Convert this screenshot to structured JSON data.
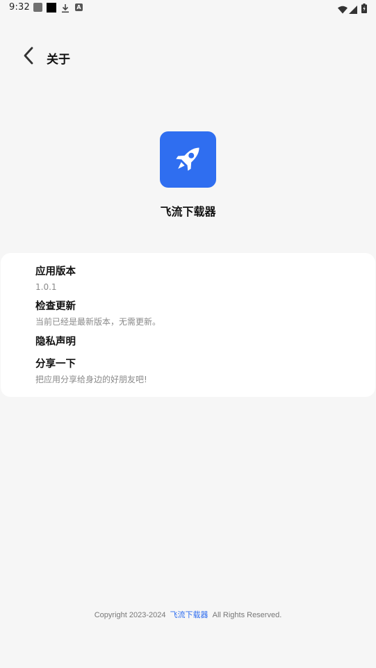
{
  "status_bar": {
    "time": "9:32",
    "icons": [
      "gray-square-icon",
      "black-square-icon",
      "download-icon",
      "a-badge-icon",
      "wifi-icon",
      "signal-icon",
      "battery-icon"
    ]
  },
  "header": {
    "title": "关于",
    "back_icon": "chevron-left-icon"
  },
  "app": {
    "name": "飞流下载器",
    "icon": "rocket-icon",
    "icon_bg": "#2f6ef0"
  },
  "info": {
    "items": [
      {
        "title": "应用版本",
        "subtitle": "1.0.1"
      },
      {
        "title": "检查更新",
        "subtitle": "当前已经是最新版本，无需更新。"
      },
      {
        "title": "隐私声明",
        "subtitle": ""
      },
      {
        "title": "分享一下",
        "subtitle": "把应用分享给身边的好朋友吧!"
      }
    ]
  },
  "footer": {
    "prefix": "Copyright 2023-2024",
    "brand": "飞流下载器",
    "suffix": "All Rights Reserved.",
    "brand_color": "#2f6ef0"
  }
}
